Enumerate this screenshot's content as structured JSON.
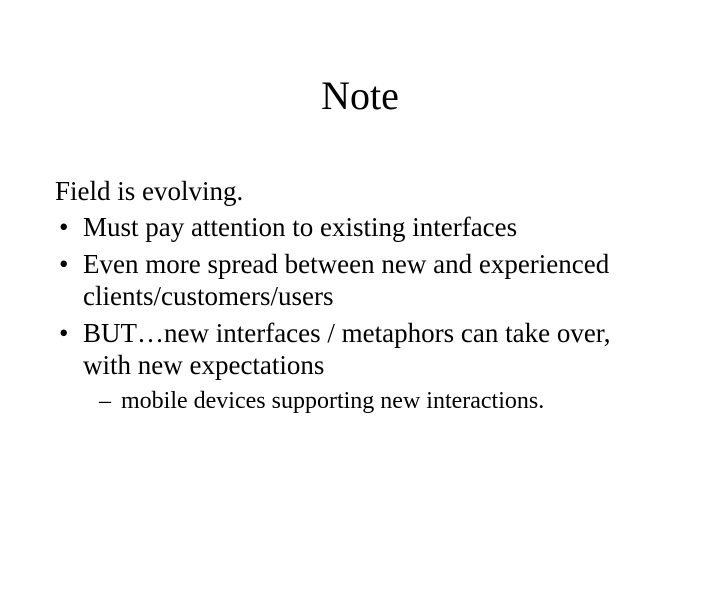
{
  "title": "Note",
  "intro": "Field is evolving.",
  "bullets": [
    "Must pay attention to existing interfaces",
    "Even more spread between new and experienced clients/customers/users",
    "BUT…new interfaces / metaphors can take over, with new expectations"
  ],
  "sub": [
    "mobile devices supporting new interactions."
  ]
}
